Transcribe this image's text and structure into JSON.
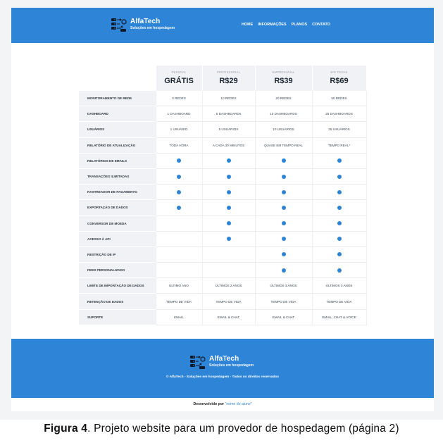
{
  "brand": {
    "name": "AlfaTech",
    "tagline": "Soluções em hospedagem"
  },
  "nav": [
    "HOME",
    "INFORMAÇÕES",
    "PLANOS",
    "CONTATO"
  ],
  "pricing": {
    "plans": [
      {
        "tier": "PESSOAL",
        "price": "GRÁTIS"
      },
      {
        "tier": "PROFISSIONAL",
        "price": "R$29"
      },
      {
        "tier": "EMPRESARIAL",
        "price": "R$39"
      },
      {
        "tier": "BIG TECHS",
        "price": "R$69"
      }
    ],
    "features": [
      {
        "label": "MONITORAMENTO DE REDE",
        "cells": [
          "3 REDES",
          "10 REDES",
          "20 REDES",
          "50 REDES"
        ]
      },
      {
        "label": "DASHBOARD",
        "cells": [
          "1 DASHBOARD",
          "5 DASHBOARDs",
          "10 DASHBOARDS",
          "25 DASHBOARDS"
        ]
      },
      {
        "label": "USUÁRIOS",
        "cells": [
          "1 USUÁRIO",
          "5 USUÁRIOS",
          "10 USUÁRIOS",
          "25 USUÁRIOS"
        ]
      },
      {
        "label": "RELATÓRIO DE ATUALIZAÇÃO",
        "cells": [
          "TODA HORA",
          "A CADA 30 MINUTOS",
          "QUASE EM TEMPO REAL",
          "TEMPO REAL*"
        ]
      },
      {
        "label": "RELATÓRIOS DE EMAILS",
        "cells": [
          true,
          true,
          true,
          true
        ]
      },
      {
        "label": "TRANSAÇÕES ILIMITADAS",
        "cells": [
          true,
          true,
          true,
          true
        ]
      },
      {
        "label": "RASTREADOR DE PAGAMENTO",
        "cells": [
          true,
          true,
          true,
          true
        ]
      },
      {
        "label": "EXPORTAÇÃO DE DADOS",
        "cells": [
          true,
          true,
          true,
          true
        ]
      },
      {
        "label": "CONVERSOR DE MOEDA",
        "cells": [
          false,
          true,
          true,
          true
        ]
      },
      {
        "label": "ACESSO À API",
        "cells": [
          false,
          true,
          true,
          true
        ]
      },
      {
        "label": "RESTRIÇÃO DE IP",
        "cells": [
          false,
          false,
          true,
          true
        ]
      },
      {
        "label": "FEED PERSONALIZADO",
        "cells": [
          false,
          false,
          true,
          true
        ]
      },
      {
        "label": "LIMITE DE IMPORTAÇÃO DE DADOS",
        "cells": [
          "ÚLTIMO ANO",
          "ÚLTIMOS 2 ANOS",
          "ÚLTIMOS 3 ANOS",
          "ÚLTIMOS 3 ANOS"
        ]
      },
      {
        "label": "RETENÇÃO DE DADOS",
        "cells": [
          "TEMPO DE VIDA",
          "TEMPO DE VIDA",
          "TEMPO DE VIDA",
          "TEMPO DE VIDA"
        ]
      },
      {
        "label": "SUPORTE",
        "cells": [
          "EMAIL",
          "EMAIL & CHAT",
          "EMAIL & CHAT",
          "EMAIL, CHAT & VOICE"
        ]
      }
    ]
  },
  "footer": {
    "copyright": "© AlfaTech - Soluções em hospedagem - Todos os direitos reservados",
    "developed_by": "Desenvolvido por",
    "student": "\"nome do aluno\""
  },
  "caption": {
    "label": "Figura 4",
    "text": ". Projeto website para um provedor de hospedagem (página 2)"
  },
  "colors": {
    "primary": "#2e84d6",
    "feature_bg": "#f1f2f5"
  },
  "icons": {
    "logo": "server-network-icon",
    "included": "check-dot-icon"
  }
}
